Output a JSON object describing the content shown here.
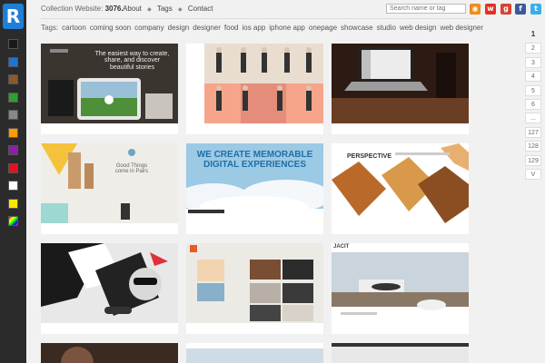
{
  "header": {
    "site_prefix": "Collection Website:",
    "site_count": "3076.",
    "nav": [
      "About",
      "Tags",
      "Contact"
    ],
    "search_placeholder": "Search name or tag"
  },
  "social_icons": [
    "rss-icon",
    "weibo-icon",
    "google-plus-icon",
    "facebook-icon",
    "twitter-icon"
  ],
  "color_filters": [
    "#1a1a1a",
    "#1e73d6",
    "#8a5a2e",
    "#2fa02f",
    "#888888",
    "#ff9a00",
    "#8a1fa8",
    "#e3131e",
    "#ffffff",
    "#ffe600",
    "multi"
  ],
  "tags": {
    "label": "Tags:",
    "items": [
      "cartoon",
      "coming soon",
      "company",
      "design",
      "designer",
      "food",
      "ios app",
      "iphone app",
      "onepage",
      "showcase",
      "studio",
      "web design",
      "web designer"
    ]
  },
  "cards": [
    {
      "caption": "The easiest way to create, share, and discover beautiful stories"
    },
    {
      "caption": ""
    },
    {
      "caption": ""
    },
    {
      "caption": "Good Things come in Pairs"
    },
    {
      "caption": "WE CREATE MEMORABLE DIGITAL EXPERIENCES"
    },
    {
      "caption": "PERSPECTIVE"
    },
    {
      "caption": ""
    },
    {
      "caption": ""
    },
    {
      "caption": "JACIT"
    }
  ],
  "pagination": [
    "1",
    "2",
    "3",
    "4",
    "5",
    "6",
    "...",
    "127",
    "128",
    "129",
    "V"
  ]
}
